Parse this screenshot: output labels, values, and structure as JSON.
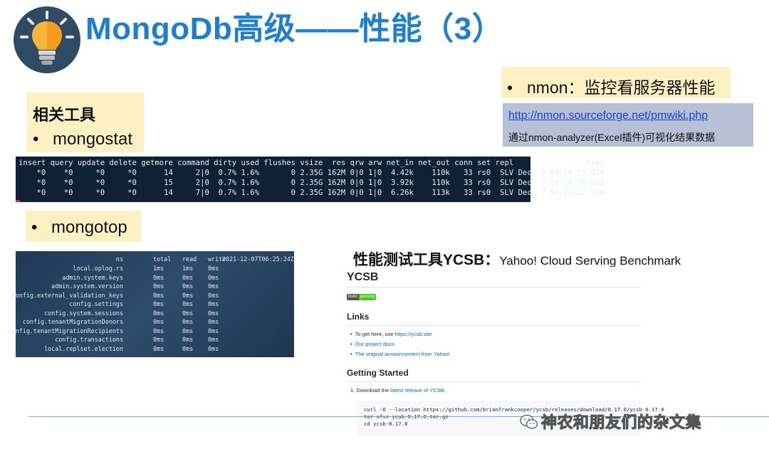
{
  "title": "MongoDb高级——性能（3）",
  "logo_icon": "lightbulb-icon",
  "tools_heading": "相关工具",
  "bullet": "•",
  "mongostat_label": "mongostat",
  "mongotop_label": "mongotop",
  "nmon": {
    "label": "nmon：监控看服务器性能",
    "link": "http://nmon.sourceforge.net/pmwiki.php",
    "desc": "通过nmon-analyzer(Excel插件)可视化结果数据"
  },
  "mongostat": {
    "header": "insert query update delete getmore command dirty used flushes vsize  res qrw arw net_in net_out conn set repl                time",
    "rows": [
      "    *0    *0     *0     *0      14     2|0  0.7% 1.6%       0 2.35G 162M 0|0 1|0  4.42k    110k   33 rs0  SLV Dec  7 06:24:55.924",
      "    *0    *0     *0     *0      15     2|0  0.7% 1.6%       0 2.35G 162M 0|0 1|0  3.92k    110k   33 rs0  SLV Dec  7 06:24:56.923",
      "    *0    *0     *0     *0      14     7|0  0.7% 1.6%       0 2.35G 162M 0|0 1|0  6.26k    113k   33 rs0  SLV Dec  7 06:24:57.924"
    ]
  },
  "mongotop": {
    "header": {
      "ns": "ns",
      "total": "total",
      "read": "read",
      "write": "write",
      "time": "2021-12-07T06:25:24Z"
    },
    "rows": [
      {
        "ns": "local.oplog.rs",
        "total": "1ms",
        "read": "1ms",
        "write": "0ms"
      },
      {
        "ns": "admin.system.keys",
        "total": "0ms",
        "read": "0ms",
        "write": "0ms"
      },
      {
        "ns": "admin.system.version",
        "total": "0ms",
        "read": "0ms",
        "write": "0ms"
      },
      {
        "ns": "config.external_validation_keys",
        "total": "0ms",
        "read": "0ms",
        "write": "0ms"
      },
      {
        "ns": "config.settings",
        "total": "0ms",
        "read": "0ms",
        "write": "0ms"
      },
      {
        "ns": "config.system.sessions",
        "total": "0ms",
        "read": "0ms",
        "write": "0ms"
      },
      {
        "ns": "config.tenantMigrationDonors",
        "total": "0ms",
        "read": "0ms",
        "write": "0ms"
      },
      {
        "ns": "config.tenantMigrationRecipients",
        "total": "0ms",
        "read": "0ms",
        "write": "0ms"
      },
      {
        "ns": "config.transactions",
        "total": "0ms",
        "read": "0ms",
        "write": "0ms"
      },
      {
        "ns": "local.replset.election",
        "total": "0ms",
        "read": "0ms",
        "write": "0ms"
      }
    ]
  },
  "ycsb": {
    "heading_big": "性能测试工具YCSB：",
    "heading_small": "Yahoo! Cloud Serving Benchmark",
    "page_title": "YCSB",
    "badge_left": "build",
    "badge_right": "passing",
    "links_heading": "Links",
    "links": [
      {
        "prefix": "To get here, use ",
        "link": "https://ycsb.site"
      },
      {
        "prefix": "",
        "link": "Our project docs"
      },
      {
        "prefix": "",
        "link": "The original announcement from Yahoo!"
      }
    ],
    "getting_started": "Getting Started",
    "step1_prefix": "1. Download the ",
    "step1_link": "latest release of YCSB",
    "step1_suffix": ":",
    "code": [
      "curl -O --location https://github.com/brianfrankcooper/ycsb/releases/download/0.17.0/ycsb-0.17.0",
      "tar xfvz ycsb-0.17.0.tar.gz",
      "cd ycsb-0.17.0"
    ]
  },
  "watermark": "神农和朋友们的杂文集",
  "watermark_icon": "wechat-icon"
}
